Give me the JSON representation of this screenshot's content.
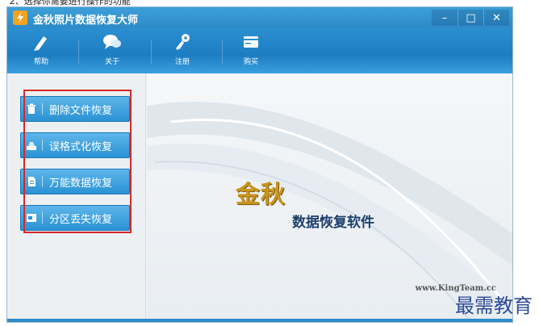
{
  "caption": "“2、选择你需要进行操作的功能”",
  "window": {
    "title": "金秋照片数据恢复大师",
    "controls": {
      "minimize": "–",
      "maximize": "□",
      "close": "✕"
    }
  },
  "toolbar": {
    "items": [
      {
        "label": "帮助",
        "icon": "help-icon"
      },
      {
        "label": "关于",
        "icon": "about-icon"
      },
      {
        "label": "注册",
        "icon": "register-key-icon"
      },
      {
        "label": "购买",
        "icon": "buy-icon"
      }
    ]
  },
  "sidebar": {
    "items": [
      {
        "label": "删除文件恢复",
        "icon": "trash-icon"
      },
      {
        "label": "误格式化恢复",
        "icon": "format-icon"
      },
      {
        "label": "万能数据恢复",
        "icon": "document-icon"
      },
      {
        "label": "分区丢失恢复",
        "icon": "partition-icon"
      }
    ]
  },
  "main": {
    "brand_title": "金秋",
    "brand_subtitle": "数据恢复软件",
    "site_url": "www.KingTeam.cc"
  },
  "watermark": "最需教育",
  "colors": {
    "primary": "#2d8bc8",
    "highlight": "#d42828",
    "brand_gold": "#c9941e",
    "brand_navy": "#1d3f6c"
  }
}
